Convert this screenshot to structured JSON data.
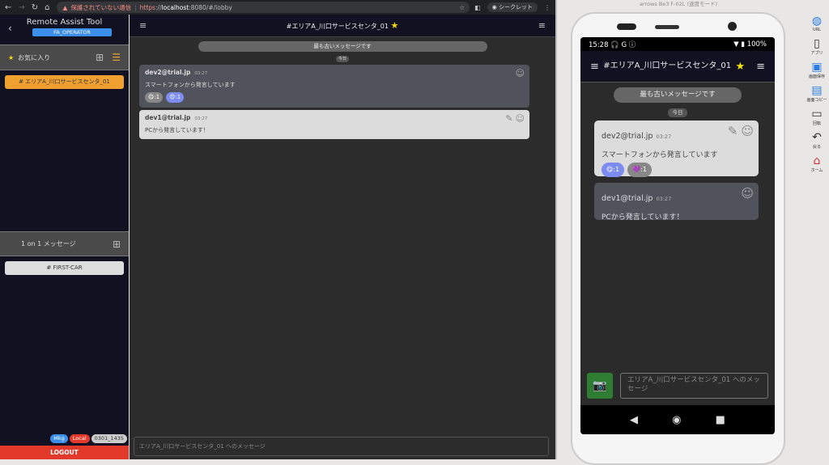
{
  "browser": {
    "warning": "保護されていない通信",
    "url_scheme": "https",
    "url_host": "localhost",
    "url_rest": ":8080/#/lobby",
    "incognito": "シークレット"
  },
  "sidebar": {
    "title": "Remote Assist Tool",
    "role": "FA_OPERATOR",
    "favorites_label": "お気に入り",
    "favorite_channels": [
      "# エリアA_川口サービスセンタ_01"
    ],
    "dm_label": "1 on 1 メッセージ",
    "dm_channels": [
      "# FIRST-CAR"
    ],
    "badges": [
      "Mkg",
      "Local",
      "0301_1435"
    ],
    "logout": "LOGOUT"
  },
  "main": {
    "channel_title": "#エリアA_川口サービスセンタ_01",
    "oldest": "最も古いメッセージです",
    "today": "今日",
    "messages": [
      {
        "user": "dev2@trial.jp",
        "time": "03:27",
        "text": "スマートフォンから発言しています",
        "reactions": [
          "😋:1",
          "😍:1"
        ]
      },
      {
        "user": "dev1@trial.jp",
        "time": "03:27",
        "text": "PCから発言しています！"
      }
    ],
    "input_placeholder": "エリアA_川口サービスセンタ_01 へのメッセージ"
  },
  "simulator": {
    "title": "arrows Be3 F-02L (速度モード)",
    "status_time": "15:28",
    "status_icons": "🎧 G ⓘ",
    "battery": "100%",
    "channel_title": "#エリアA_川口サービスセンタ_01",
    "oldest": "最も古いメッセージです",
    "today": "今日",
    "messages": [
      {
        "user": "dev2@trial.jp",
        "time": "03:27",
        "text": "スマートフォンから発言しています",
        "reactions": [
          "😋:1",
          "💜:1"
        ]
      },
      {
        "user": "dev1@trial.jp",
        "time": "03:27",
        "text": "PCから発言しています！"
      }
    ],
    "input_placeholder": "エリアA_川口サービスセンタ_01 へのメッセージ",
    "tools": [
      "URL",
      "アプリ",
      "画面保存",
      "画面コピー",
      "回転",
      "戻る",
      "ホーム"
    ]
  }
}
